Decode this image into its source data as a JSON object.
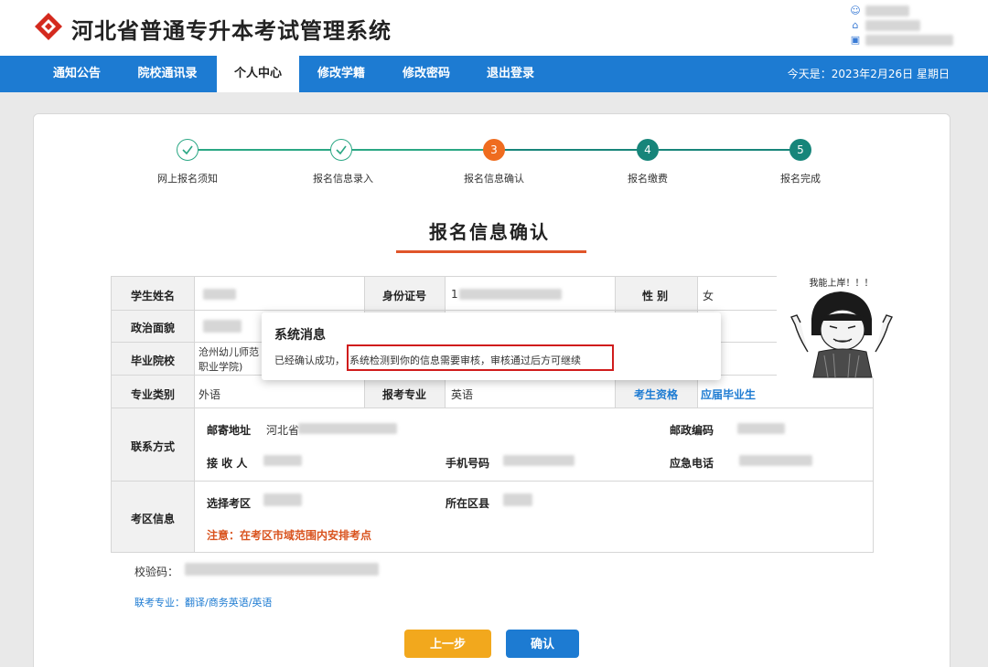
{
  "header": {
    "title": "河北省普通专升本考试管理系统"
  },
  "nav": {
    "items": [
      {
        "label": "通知公告"
      },
      {
        "label": "院校通讯录"
      },
      {
        "label": "个人中心"
      },
      {
        "label": "修改学籍"
      },
      {
        "label": "修改密码"
      },
      {
        "label": "退出登录"
      }
    ],
    "active_index": 2,
    "today": "今天是：2023年2月26日 星期日"
  },
  "steps": [
    {
      "label": "网上报名须知",
      "state": "done"
    },
    {
      "label": "报名信息录入",
      "state": "done"
    },
    {
      "label": "报名信息确认",
      "num": "3",
      "state": "current"
    },
    {
      "label": "报名缴费",
      "num": "4",
      "state": "todo"
    },
    {
      "label": "报名完成",
      "num": "5",
      "state": "todo"
    }
  ],
  "page_heading": "报名信息确认",
  "form": {
    "student_name_label": "学生姓名",
    "id_label": "身份证号",
    "id_value_prefix": "1",
    "gender_label": "性 别",
    "gender_value": "女",
    "political_label": "政治面貌",
    "school_label": "毕业院校",
    "school_value_line1": "沧州幼儿师范",
    "school_value_line2": "职业学院)",
    "major_cat_label": "专业类别",
    "major_cat_value": "外语",
    "apply_major_label": "报考专业",
    "apply_major_value": "英语",
    "qualification_label": "考生资格",
    "qualification_value": "应届毕业生",
    "contact_label": "联系方式",
    "address_label": "邮寄地址",
    "address_value_prefix": "河北省",
    "postcode_label": "邮政编码",
    "receiver_label": "接 收 人",
    "mobile_label": "手机号码",
    "emergency_label": "应急电话",
    "exam_area_label": "考区信息",
    "select_area_label": "选择考区",
    "county_label": "所在区县",
    "notice": "注意：在考区市域范围内安排考点"
  },
  "checksum_label": "校验码：",
  "joint_major": "联考专业：翻译/商务英语/英语",
  "buttons": {
    "prev": "上一步",
    "confirm": "确认"
  },
  "modal": {
    "title": "系统消息",
    "msg_a": "已经确认成功，",
    "msg_b": "系统检测到你的信息需要审核，审核通过后方可继续"
  },
  "sticker": {
    "text": "我能上岸！！！"
  },
  "colors": {
    "nav_blue": "#1d7bd2",
    "step_done": "#2aa784",
    "step_current": "#ef6c1f",
    "step_todo": "#17857a",
    "accent_orange": "#e0552a",
    "alert_red": "#d01c1c"
  }
}
